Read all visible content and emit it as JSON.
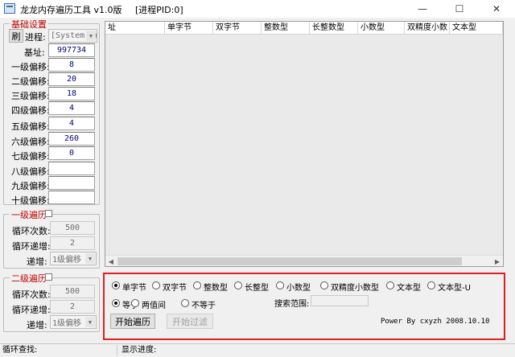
{
  "window": {
    "title": "龙龙内存遍历工具 v1.0版",
    "pid_label": "[进程PID:0]",
    "minimize": "—",
    "maximize": "☐",
    "close": "✕"
  },
  "base_group": {
    "title": "基础设置",
    "refresh_button": "刷",
    "process_label": "进程:",
    "process_value": "[System Pro",
    "base_label": "基址:",
    "base_value": "997734",
    "offsets": [
      {
        "label": "一级偏移:",
        "value": "8"
      },
      {
        "label": "二级偏移:",
        "value": "20"
      },
      {
        "label": "三级偏移:",
        "value": "18"
      },
      {
        "label": "四级偏移:",
        "value": "4"
      },
      {
        "label": "五级偏移:",
        "value": "4"
      },
      {
        "label": "六级偏移:",
        "value": "260"
      },
      {
        "label": "七级偏移:",
        "value": "0"
      },
      {
        "label": "八级偏移:",
        "value": ""
      },
      {
        "label": "九级偏移:",
        "value": ""
      },
      {
        "label": "十级偏移:",
        "value": ""
      }
    ]
  },
  "level1_group": {
    "title": "一级遍历",
    "loop_count_label": "循环次数:",
    "loop_count_value": "500",
    "loop_step_label": "循环递增:",
    "loop_step_value": "2",
    "step_label": "递增:",
    "step_value": "1级偏移"
  },
  "level2_group": {
    "title": "二级遍历",
    "loop_count_label": "循环次数:",
    "loop_count_value": "500",
    "loop_step_label": "循环递增:",
    "loop_step_value": "2",
    "step_label": "递增:",
    "step_value": "1级偏移"
  },
  "list": {
    "columns": [
      "址",
      "单字节",
      "双字节",
      "整数型",
      "长整数型",
      "小数型",
      "双精度小数",
      "文本型"
    ]
  },
  "search": {
    "types": [
      "单字节",
      "双字节",
      "整数型",
      "长整型",
      "小数型",
      "双精度小数型",
      "文本型",
      "文本型-U"
    ],
    "selected_type": "单字节",
    "conditions": [
      "等于",
      "两值间",
      "不等于"
    ],
    "selected_condition": "等于",
    "range_label": "搜索范围:",
    "range_value": "",
    "start_button": "开始遍历",
    "filter_button": "开始过滤",
    "credit": "Power By cxyzh 2008.10.10"
  },
  "status": {
    "loop_find_label": "循环查找:",
    "progress_label": "显示进度:"
  }
}
